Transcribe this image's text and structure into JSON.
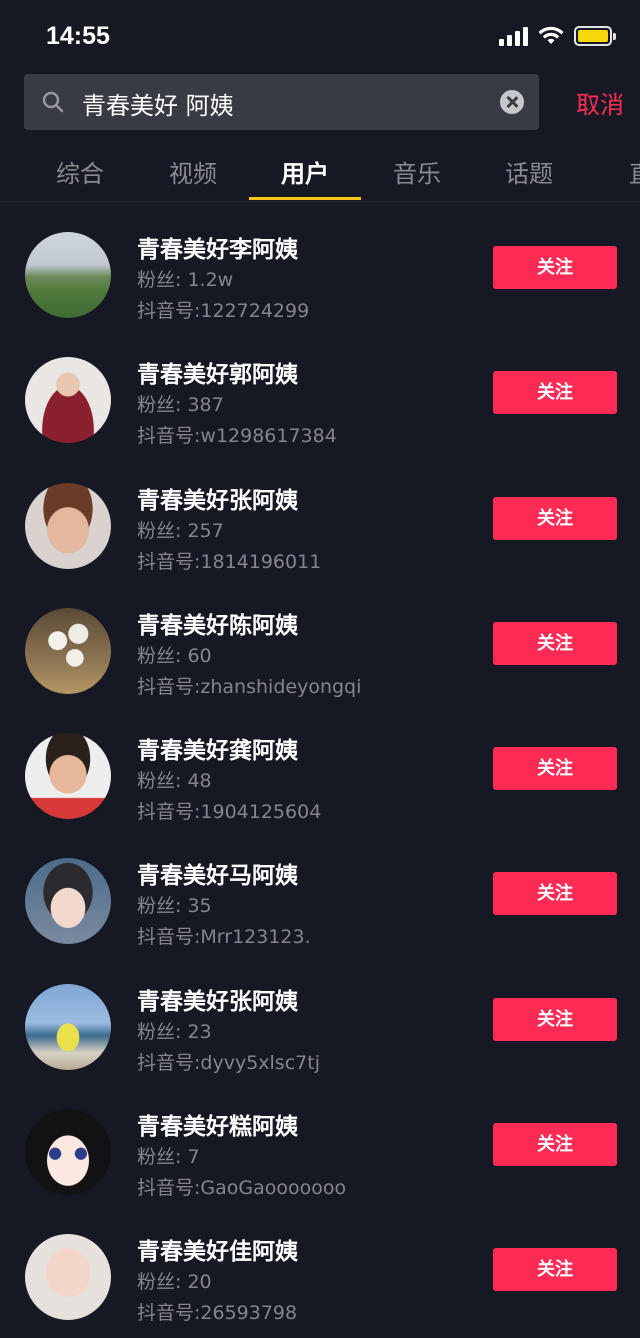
{
  "status_bar": {
    "time": "14:55",
    "battery_color": "#f5d90a"
  },
  "search": {
    "query": "青春美好 阿姨",
    "cancel_label": "取消"
  },
  "tabs": [
    {
      "label": "综合",
      "active": false
    },
    {
      "label": "视频",
      "active": false
    },
    {
      "label": "用户",
      "active": true
    },
    {
      "label": "音乐",
      "active": false
    },
    {
      "label": "话题",
      "active": false
    },
    {
      "label": "直",
      "active": false
    }
  ],
  "follow_label": "关注",
  "users": [
    {
      "name": "青春美好李阿姨",
      "fans": "粉丝: 1.2w",
      "id": "抖音号:122724299",
      "avatar_desc": "landscape-photo"
    },
    {
      "name": "青春美好郭阿姨",
      "fans": "粉丝: 387",
      "id": "抖音号:w1298617384",
      "avatar_desc": "woman-red-coat-photo"
    },
    {
      "name": "青春美好张阿姨",
      "fans": "粉丝: 257",
      "id": "抖音号:1814196011",
      "avatar_desc": "woman-glasses-photo"
    },
    {
      "name": "青春美好陈阿姨",
      "fans": "粉丝: 60",
      "id": "抖音号:zhanshideyongqi",
      "avatar_desc": "white-flowers-photo"
    },
    {
      "name": "青春美好龚阿姨",
      "fans": "粉丝: 48",
      "id": "抖音号:1904125604",
      "avatar_desc": "smiling-woman-photo"
    },
    {
      "name": "青春美好马阿姨",
      "fans": "粉丝: 35",
      "id": "抖音号:Mrr123123.",
      "avatar_desc": "young-woman-selfie"
    },
    {
      "name": "青春美好张阿姨",
      "fans": "粉丝: 23",
      "id": "抖音号:dyvy5xlsc7tj",
      "avatar_desc": "woman-yellow-coat-beach"
    },
    {
      "name": "青春美好糕阿姨",
      "fans": "粉丝: 7",
      "id": "抖音号:GaoGaooooooo",
      "avatar_desc": "anime-girl"
    },
    {
      "name": "青春美好佳阿姨",
      "fans": "粉丝: 20",
      "id": "抖音号:26593798",
      "avatar_desc": "child-photo"
    }
  ],
  "colors": {
    "background": "#161823",
    "accent": "#fe2c55",
    "tab_indicator": "#f5c518"
  }
}
